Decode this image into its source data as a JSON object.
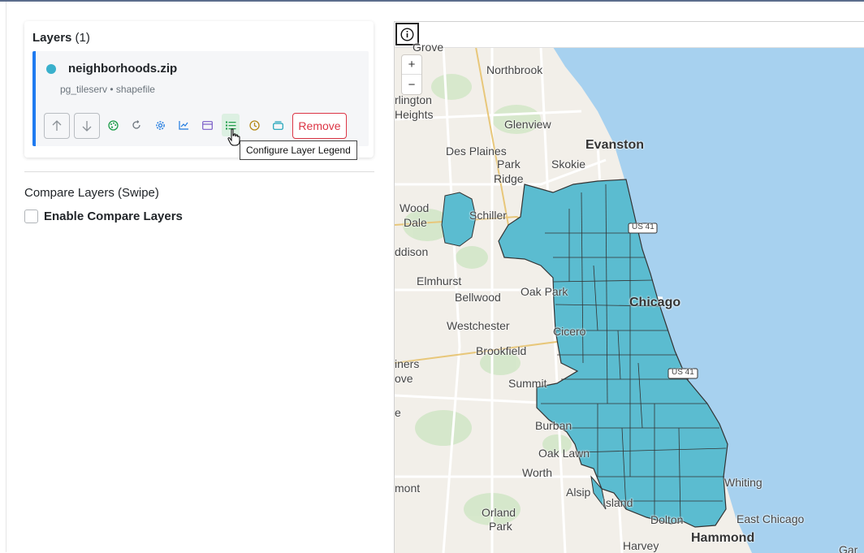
{
  "layers_panel": {
    "title": "Layers",
    "count": "(1)",
    "layer": {
      "name": "neighborhoods.zip",
      "subtitle": "pg_tileserv • shapefile",
      "color": "#39b0cc",
      "icons": [
        "palette-icon",
        "refresh-icon",
        "settings-icon",
        "chart-icon",
        "table-icon",
        "legend-icon",
        "clock-icon",
        "layers-icon"
      ],
      "remove_label": "Remove"
    },
    "tooltip": "Configure Layer Legend"
  },
  "compare": {
    "title": "Compare Layers (Swipe)",
    "checkbox_label": "Enable Compare Layers",
    "checked": false
  },
  "map": {
    "zoom_in": "+",
    "zoom_out": "−",
    "water_color": "#a7d1ef",
    "land_color": "#f2efe9",
    "fill_color": "#5bbcd0",
    "labels": {
      "grove": "Grove",
      "northbrook": "Northbrook",
      "arlington": "rlington",
      "heights": "Heights",
      "glenview": "Glenview",
      "des_plaines": "Des Plaines",
      "evanston": "Evanston",
      "park": "Park",
      "ridge": "Ridge",
      "skokie": "Skokie",
      "wood": "Wood",
      "dale": "Dale",
      "schiller": "Schiller",
      "ddison": "ddison",
      "elmhurst": "Elmhurst",
      "oak_park": "Oak Park",
      "bellwood": "Bellwood",
      "chicago": "Chicago",
      "westchester": "Westchester",
      "cicero": "Cicero",
      "brookfield": "Brookfield",
      "iners": "iners",
      "ove": "ove",
      "summit": "Summit",
      "e": "e",
      "burbank": "Burban",
      "oak_lawn": "Oak Lawn",
      "worth": "Worth",
      "mont": "mont",
      "alsip": "Alsip",
      "island": "Island",
      "whiting": "Whiting",
      "orland": "Orland",
      "orland_park": "Park",
      "east_chicago": "East Chicago",
      "harvey": "Harvey",
      "hammond": "Hammond",
      "dolton": "Dolton",
      "gar": "Gar",
      "us41a": "US 41",
      "us41b": "US 41"
    }
  }
}
